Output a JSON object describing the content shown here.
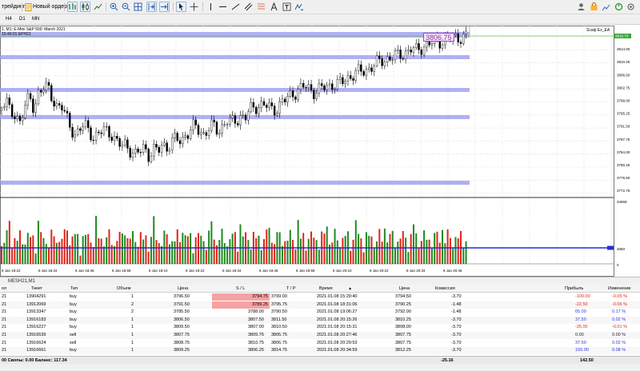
{
  "toolbar": {
    "algo_label": "трейдинг",
    "new_order_label": "Новый ордер"
  },
  "timeframes": [
    "H4",
    "D1",
    "MN"
  ],
  "chart": {
    "title": "1, M1: E-Mini S&P 500: March 2021",
    "subtitle": "15:40:01 EPH21",
    "ea_label": "Scalp Ex_EA",
    "current_price_tag": "3806.75",
    "bid_price_label": "3816.75",
    "price_axis": [
      "3816.75",
      "3814.00",
      "3810.25",
      "3806.50",
      "3802.75",
      "3799.00",
      "3795.25",
      "3791.50",
      "3787.75",
      "3784.00",
      "3780.25",
      "3776.50",
      "3772.75"
    ],
    "volume_axis": [
      "34659",
      "4650",
      "0"
    ],
    "volume_marker": "4650",
    "time_axis": [
      "8 Jan 18:22",
      "8 Jan 18:34",
      "8 Jan 18:46",
      "8 Jan 18:58",
      "8 Jan 19:10",
      "8 Jan 19:22",
      "8 Jan 19:34",
      "8 Jan 19:46",
      "8 Jan 19:58",
      "8 Jan 20:10",
      "8 Jan 20:22",
      "8 Jan 20:34",
      "8 Jan 20:46"
    ],
    "colors": {
      "bull": "#1f8a1f",
      "bear": "#e0241b",
      "level_band": "#9c9cf0",
      "level_dark": "#2a2ad4"
    }
  },
  "tab_label": "MESH21,M1",
  "table": {
    "headers": {
      "symbol": "ол",
      "ticket": "Тикет",
      "type": "Тип",
      "volume": "Объем",
      "price": "Цена",
      "sl": "S / L",
      "tp": "T / P",
      "time": "Время",
      "price2": "Цена",
      "commission": "Комиссия",
      "profit": "Прибыль",
      "change": "Изменение"
    },
    "sort_indicator": "▲",
    "rows": [
      {
        "sym": "21",
        "ticket": "13904291",
        "type": "buy",
        "vol": "1",
        "price": "3796.50",
        "sl": "3794.75",
        "tp": "3799.00",
        "time": "2021.01.08 15:29:40",
        "price2": "3794.50",
        "comm": "-3.70",
        "profit": "-100.00",
        "change": "-0.05 %",
        "tone": "neg",
        "sl_hi": true
      },
      {
        "sym": "21",
        "ticket": "13912069",
        "type": "buy",
        "vol": "2",
        "price": "3791.50",
        "sl": "3789.25",
        "tp": "3795.75",
        "time": "2021.01.08 18:31:06",
        "price2": "3790.25",
        "comm": "-1.48",
        "profit": "-22.50",
        "change": "-0.06 %",
        "tone": "neg",
        "sl_hi": true
      },
      {
        "sym": "21",
        "ticket": "13913347",
        "type": "buy",
        "vol": "2",
        "price": "3785.50",
        "sl": "3788.00",
        "tp": "3790.50",
        "time": "2021.01.08 19:06:27",
        "price2": "3792.00",
        "comm": "-1.48",
        "profit": "65.00",
        "change": "0.17 %",
        "tone": "pos",
        "sl_hi": false
      },
      {
        "sym": "21",
        "ticket": "13916183",
        "type": "buy",
        "vol": "1",
        "price": "3806.50",
        "sl": "3807.50",
        "tp": "3811.50",
        "time": "2021.01.08 20:15:26",
        "price2": "3810.25",
        "comm": "-3.70",
        "profit": "37.50",
        "change": "0.02 %",
        "tone": "pos",
        "sl_hi": false
      },
      {
        "sym": "21",
        "ticket": "13916227",
        "type": "buy",
        "vol": "1",
        "price": "3809.50",
        "sl": "3807.00",
        "tp": "3810.50",
        "time": "2021.01.08 20:15:31",
        "price2": "3808.00",
        "comm": "-3.70",
        "profit": "-25.00",
        "change": "-0.01 %",
        "tone": "neg",
        "sl_hi": false
      },
      {
        "sym": "21",
        "ticket": "13916539",
        "type": "sell",
        "vol": "1",
        "price": "3807.75",
        "sl": "3809.75",
        "tp": "3805.75",
        "time": "2021.01.08 20:27:46",
        "price2": "3807.75",
        "comm": "-3.70",
        "profit": "0.00",
        "change": "0.00 %",
        "tone": "zero",
        "sl_hi": false
      },
      {
        "sym": "21",
        "ticket": "13916624",
        "type": "sell",
        "vol": "1",
        "price": "3808.75",
        "sl": "3810.75",
        "tp": "3806.75",
        "time": "2021.01.08 20:29:53",
        "price2": "3807.75",
        "comm": "-3.70",
        "profit": "37.50",
        "change": "0.02 %",
        "tone": "pos",
        "sl_hi": false
      },
      {
        "sym": "21",
        "ticket": "13916661",
        "type": "buy",
        "vol": "1",
        "price": "3809.25",
        "sl": "3806.25",
        "tp": "3814.75",
        "time": "2021.01.08 20:34:59",
        "price2": "3812.25",
        "comm": "-3.70",
        "profit": "150.00",
        "change": "0.08 %",
        "tone": "pos",
        "sl_hi": false
      }
    ],
    "summary": {
      "label": "00 Свопы: 0.00 Баланс: 117.34",
      "commission_total": "-25.16",
      "profit_total": "142.50"
    }
  }
}
